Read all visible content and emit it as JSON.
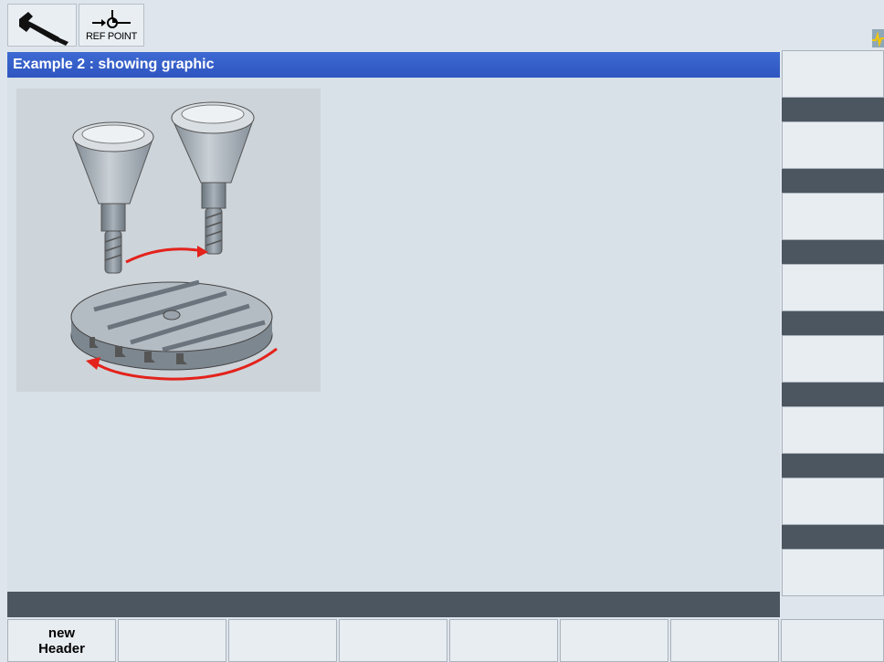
{
  "topbar": {
    "wrench_icon": "wrench-icon",
    "ref_point_icon": "ref-point-icon",
    "ref_point_label": "REF POINT"
  },
  "window": {
    "title": "Example 2 : showing graphic"
  },
  "graphic": {
    "description_icon": "rotary-table-tool-change-graphic",
    "colors": {
      "arrow": "#e3221b",
      "metal": "#a3adb6",
      "background": "#cdd4da"
    }
  },
  "vertical_softkeys": [
    "",
    "",
    "",
    "",
    "",
    "",
    "",
    ""
  ],
  "horizontal_softkeys": [
    {
      "line1": "new",
      "line2": "Header"
    },
    {
      "line1": "",
      "line2": ""
    },
    {
      "line1": "",
      "line2": ""
    },
    {
      "line1": "",
      "line2": ""
    },
    {
      "line1": "",
      "line2": ""
    },
    {
      "line1": "",
      "line2": ""
    },
    {
      "line1": "",
      "line2": ""
    },
    {
      "line1": "",
      "line2": ""
    }
  ],
  "colors": {
    "title_bar": "#3460c8",
    "background": "#dfe5ec",
    "separator": "#4b5661"
  }
}
